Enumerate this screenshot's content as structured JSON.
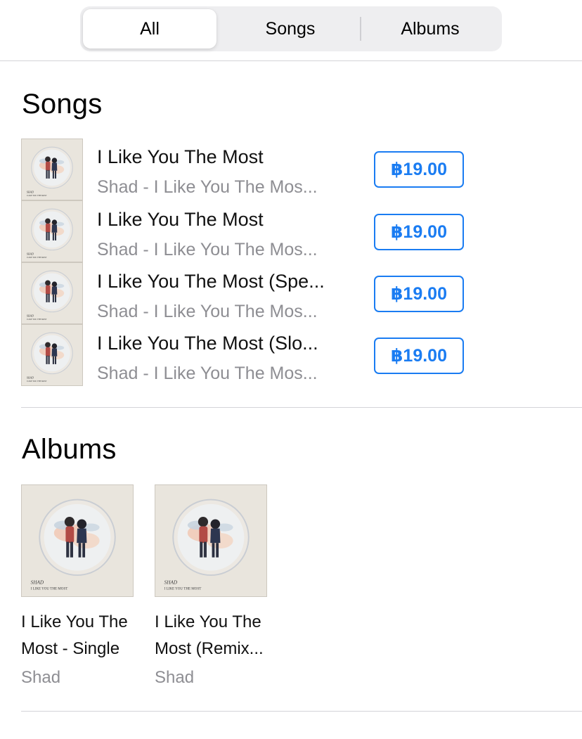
{
  "segmented_control": {
    "options": [
      "All",
      "Songs",
      "Albums"
    ],
    "selected": "All"
  },
  "songs_section": {
    "title": "Songs",
    "items": [
      {
        "title": "I Like You The Most",
        "subtitle": "Shad - I Like You The Mos...",
        "price": "฿19.00"
      },
      {
        "title": "I Like You The Most",
        "subtitle": "Shad - I Like You The Mos...",
        "price": "฿19.00"
      },
      {
        "title": "I Like You The Most (Spe...",
        "subtitle": "Shad - I Like You The Mos...",
        "price": "฿19.00"
      },
      {
        "title": "I Like You The Most (Slo...",
        "subtitle": "Shad - I Like You The Mos...",
        "price": "฿19.00"
      }
    ]
  },
  "albums_section": {
    "title": "Albums",
    "items": [
      {
        "title_line1": "I Like You The",
        "title_line2": "Most - Single",
        "artist": "Shad"
      },
      {
        "title_line1": "I Like You The",
        "title_line2": "Most (Remix...",
        "artist": "Shad"
      }
    ]
  },
  "artwork": {
    "artist_text": "SHAD",
    "title_text": "I LIKE YOU THE MOST"
  },
  "colors": {
    "accent": "#1a7cf2",
    "secondary_text": "#8e8e93",
    "segmented_bg": "#eeeef0"
  }
}
